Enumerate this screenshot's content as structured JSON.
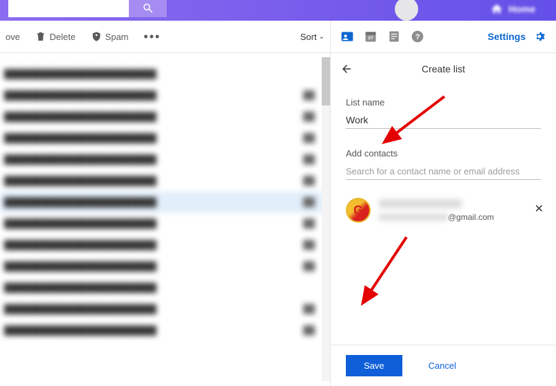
{
  "topbar": {
    "home_label": "Home"
  },
  "toolbar_left": {
    "move_label": "ove",
    "delete_label": "Delete",
    "spam_label": "Spam",
    "sort_label": "Sort"
  },
  "toolbar_right": {
    "calendar_badge": "27",
    "settings_label": "Settings"
  },
  "panel": {
    "title": "Create list",
    "list_name_label": "List name",
    "list_name_value": "Work",
    "add_contacts_label": "Add contacts",
    "add_contacts_placeholder": "Search for a contact name or email address",
    "save_label": "Save",
    "cancel_label": "Cancel"
  },
  "contact": {
    "name": "████████",
    "email_visible": "@gmail.com",
    "avatar_initial": "G"
  },
  "messages": [
    {
      "subj": "████████████████████████",
      "time": ""
    },
    {
      "subj": "████████████████████████",
      "time": "██",
      "bold": true
    },
    {
      "subj": "████████████████████████",
      "time": "██",
      "bold": true
    },
    {
      "subj": "████████████████████████",
      "time": "██"
    },
    {
      "subj": "████████████████████████",
      "time": "██",
      "bold": true
    },
    {
      "subj": "████████████████████████",
      "time": "██"
    },
    {
      "subj": "████████████████████████",
      "time": "██",
      "selected": true,
      "bold": true
    },
    {
      "subj": "████████████████████████",
      "time": "██",
      "bold": true
    },
    {
      "subj": "████████████████████████",
      "time": "██"
    },
    {
      "subj": "████████████████████████",
      "time": "██",
      "bold": true
    },
    {
      "subj": "████████████████████████",
      "time": ""
    },
    {
      "subj": "████████████████████████",
      "time": "██"
    },
    {
      "subj": "████████████████████████",
      "time": "██"
    }
  ]
}
